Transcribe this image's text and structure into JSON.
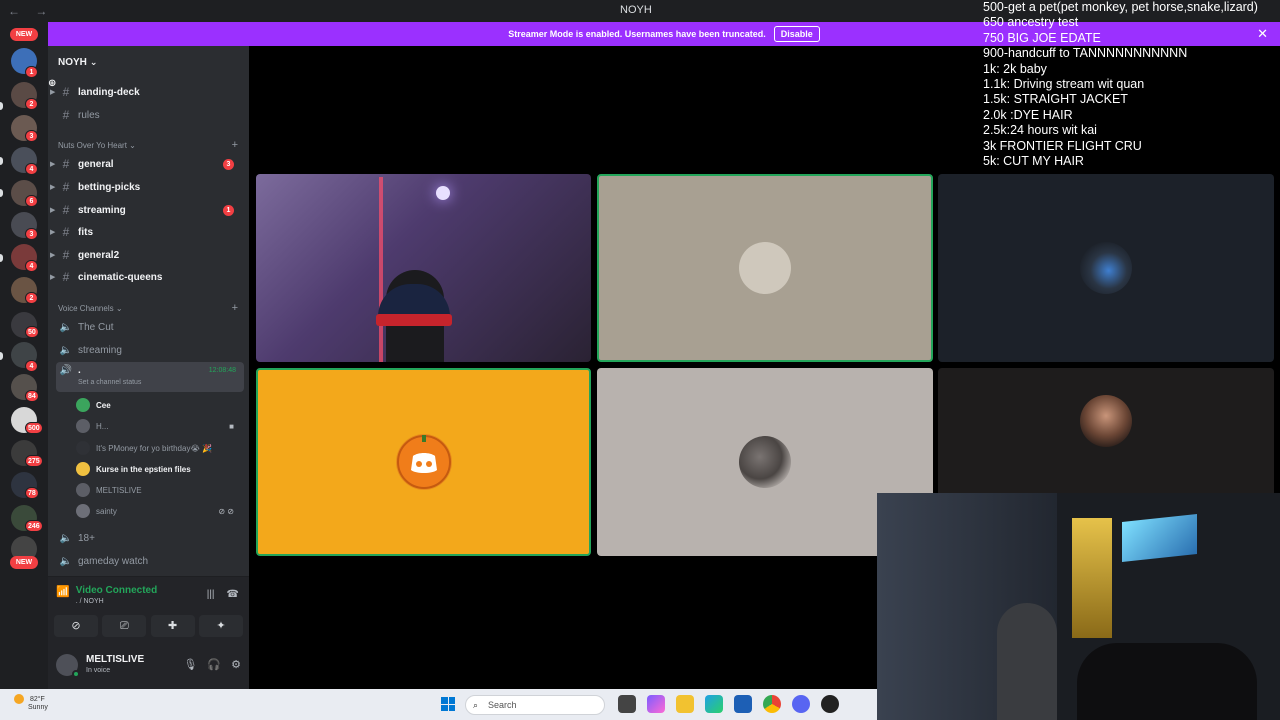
{
  "window": {
    "title": "NOYH",
    "nav_arrows": "← →"
  },
  "rail": {
    "new_label": "NEW",
    "badges": [
      "1",
      "2",
      "3",
      "4",
      "6",
      "3",
      "4",
      "2",
      "50",
      "4",
      "84",
      "500",
      "275",
      "78",
      "246"
    ],
    "bottom_new_label": "NEW"
  },
  "banner": {
    "message": "Streamer Mode is enabled. Usernames have been truncated.",
    "disable_label": "Disable",
    "close_glyph": "✕"
  },
  "guild": {
    "name": "NOYH",
    "chevron": "⌄",
    "invite_glyph": "👤"
  },
  "channels": {
    "top": [
      {
        "name": "landing-deck"
      },
      {
        "name": "rules"
      }
    ],
    "category1": "Nuts Over Yo Heart",
    "cat1_items": [
      {
        "name": "general",
        "count": "3"
      },
      {
        "name": "betting-picks"
      },
      {
        "name": "streaming",
        "count": "1"
      },
      {
        "name": "fits"
      },
      {
        "name": "general2"
      },
      {
        "name": "cinematic-queens"
      }
    ],
    "category2": "Voice Channels",
    "voice": [
      {
        "name": "The Cut"
      },
      {
        "name": "streaming"
      }
    ],
    "active_voice": {
      "name": ".",
      "timer": "12:08:48",
      "status": "Set a channel status"
    },
    "voice_users": [
      {
        "name": "Cee"
      },
      {
        "name": "H..."
      },
      {
        "name": "It's PMoney for yo birthday😭 🎉"
      },
      {
        "name": "Kurse in the epstien files"
      },
      {
        "name": "MELTISLIVE"
      },
      {
        "name": "sainty"
      }
    ],
    "more_voice": [
      {
        "name": "18+"
      },
      {
        "name": "gameday watch"
      }
    ]
  },
  "voice_panel": {
    "title": "Video Connected",
    "subtitle": ". / NOYH"
  },
  "user_panel": {
    "name": "MELTISLIVE",
    "status": "In voice"
  },
  "goals": [
    "500-get a pet(pet monkey, pet horse,snake,lizard)",
    "650 ancestry test",
    "750 BIG JOE EDATE",
    "900-handcuff to TANNNNNNNNNNN",
    "1k: 2k baby",
    "1.1k: Driving stream wit quan",
    "1.5k: STRAIGHT JACKET",
    "2.0k :DYE HAIR",
    "2.5k:24 hours wit kai",
    "3k FRONTIER FLIGHT CRU",
    "5k: CUT MY HAIR"
  ],
  "taskbar": {
    "temp": "82°F",
    "condition": "Sunny",
    "search_placeholder": "Search"
  },
  "colors": {
    "banner": "#9b30ff",
    "speaking_outline": "#23a55a",
    "discord_orange": "#f3a81b"
  }
}
